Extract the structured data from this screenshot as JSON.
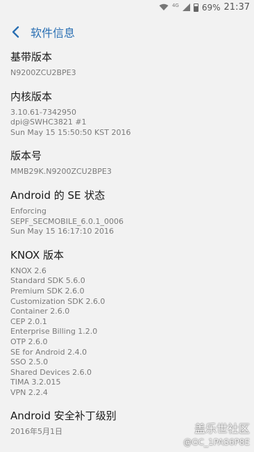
{
  "status_bar": {
    "network": "4G",
    "battery": "69%",
    "time": "21:37"
  },
  "header": {
    "title": "软件信息"
  },
  "sections": [
    {
      "title": "基带版本",
      "lines": [
        "N9200ZCU2BPE3"
      ]
    },
    {
      "title": "内核版本",
      "lines": [
        "3.10.61-7342950",
        "dpi@SWHC3821 #1",
        "Sun May 15 15:50:50 KST 2016"
      ]
    },
    {
      "title": "版本号",
      "lines": [
        "MMB29K.N9200ZCU2BPE3"
      ]
    },
    {
      "title": "Android 的 SE 状态",
      "lines": [
        "Enforcing",
        "SEPF_SECMOBILE_6.0.1_0006",
        "Sun May 15 16:17:10 2016"
      ]
    },
    {
      "title": "KNOX 版本",
      "lines": [
        "KNOX 2.6",
        "Standard SDK 5.6.0",
        "Premium SDK 2.6.0",
        "Customization SDK 2.6.0",
        "Container 2.6.0",
        "CEP 2.0.1",
        "Enterprise Billing 1.2.0",
        "OTP 2.6.0",
        "SE for Android 2.4.0",
        "SSO 2.5.0",
        "Shared Devices 2.6.0",
        "TIMA 3.2.015",
        "VPN 2.2.4"
      ]
    },
    {
      "title": "Android 安全补丁级别",
      "lines": [
        "2016年5月1日"
      ]
    }
  ],
  "watermark": {
    "line1": "盖乐世社区",
    "line2": "@GC_1PAS6P8E"
  },
  "colors": {
    "accent": "#2a6fb3",
    "background": "#f2f2f2",
    "title_text": "#1a1a1a",
    "secondary_text": "#7a7a7a"
  }
}
